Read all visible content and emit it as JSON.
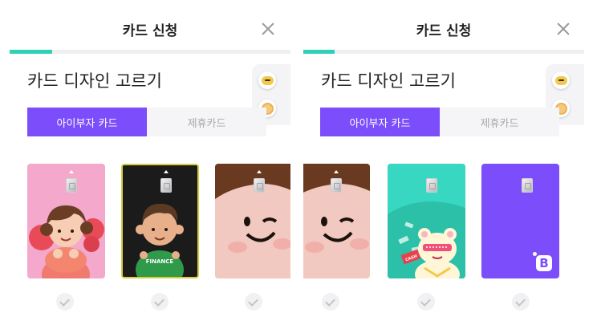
{
  "panels": [
    {
      "header": {
        "title": "카드 신청",
        "close_icon": "close-icon"
      },
      "progress": {
        "fraction": 0.15,
        "color": "#2fd1b5"
      },
      "section_title": "카드 디자인 고르기",
      "floating": {
        "icons": [
          "kakao-talk-icon",
          "coin-icon"
        ]
      },
      "tabs": [
        {
          "label": "아이부자 카드",
          "active": true
        },
        {
          "label": "제휴카드",
          "active": false
        }
      ],
      "cards": [
        {
          "name": "pink-character-card",
          "selected": false
        },
        {
          "name": "finance-character-card",
          "selected": false
        },
        {
          "name": "face-closeup-card",
          "selected": false
        }
      ]
    },
    {
      "header": {
        "title": "카드 신청",
        "close_icon": "close-icon"
      },
      "progress": {
        "fraction": 0.15,
        "color": "#2fd1b5"
      },
      "section_title": "카드 디자인 고르기",
      "floating": {
        "icons": [
          "kakao-talk-icon",
          "coin-icon"
        ]
      },
      "tabs": [
        {
          "label": "아이부자 카드",
          "active": true
        },
        {
          "label": "제휴카드",
          "active": false
        }
      ],
      "cards": [
        {
          "name": "face-closeup-card",
          "selected": false
        },
        {
          "name": "mint-bear-card",
          "selected": false
        },
        {
          "name": "purple-logo-card",
          "selected": false
        }
      ]
    }
  ],
  "colors": {
    "accent": "#7b4dfb",
    "progress": "#2fd1b5",
    "tab_inactive_bg": "#f5f5f7",
    "tab_inactive_text": "#a7a7ad"
  },
  "card_texts": {
    "finance_shirt": "FINANCE",
    "cash_sign": "CASH",
    "logo_letter": "B"
  }
}
